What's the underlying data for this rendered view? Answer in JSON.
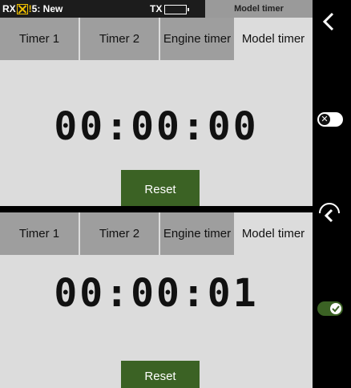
{
  "top": {
    "status": {
      "rx_label": "RX",
      "warn_mark": "!",
      "model_line": "5: New",
      "tx_label": "TX",
      "title": "Model timer"
    },
    "tabs": [
      "Timer 1",
      "Timer 2",
      "Engine timer",
      "Model timer"
    ],
    "timer_value": "00:00:00",
    "reset_label": "Reset"
  },
  "bottom": {
    "tabs": [
      "Timer 1",
      "Timer 2",
      "Engine timer",
      "Model timer"
    ],
    "timer_value": "00:00:01",
    "reset_label": "Reset"
  },
  "colors": {
    "accent": "#3b6224",
    "tab_bg": "#9e9e9e",
    "panel_bg": "#dcdcdc"
  },
  "icons": {
    "back": "back-chevron-icon",
    "toggle_off": "toggle-off-icon",
    "up": "up-chevron-icon",
    "toggle_on": "toggle-on-icon"
  }
}
